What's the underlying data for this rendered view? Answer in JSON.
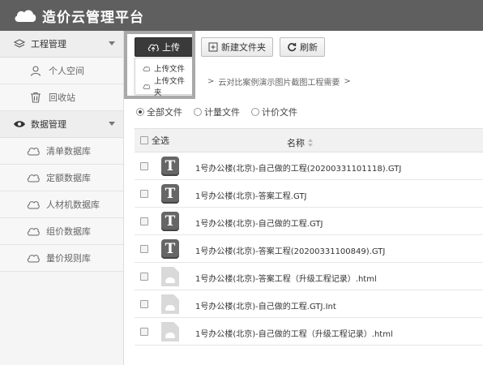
{
  "header": {
    "title": "造价云管理平台",
    "icon": "cloud-logo"
  },
  "sidebar": {
    "groups": [
      {
        "label": "工程管理",
        "icon": "layers-icon",
        "items": [
          {
            "label": "个人空间",
            "icon": "person-icon"
          },
          {
            "label": "回收站",
            "icon": "trash-icon"
          }
        ]
      },
      {
        "label": "数据管理",
        "icon": "eye-icon",
        "items": [
          {
            "label": "清单数据库",
            "icon": "cloud-icon"
          },
          {
            "label": "定额数据库",
            "icon": "cloud-icon"
          },
          {
            "label": "人材机数据库",
            "icon": "cloud-icon"
          },
          {
            "label": "组价数据库",
            "icon": "cloud-icon"
          },
          {
            "label": "量价规则库",
            "icon": "cloud-icon"
          }
        ]
      }
    ]
  },
  "toolbar": {
    "upload": "上传",
    "new_folder": "新建文件夹",
    "refresh": "刷新"
  },
  "upload_menu": {
    "items": [
      "上传文件",
      "上传文件夹"
    ]
  },
  "breadcrumb": {
    "sep": ">",
    "path": "云对比案例演示图片截图工程需要"
  },
  "filters": {
    "options": [
      "全部文件",
      "计量文件",
      "计价文件"
    ],
    "selected": "全部文件"
  },
  "table": {
    "select_all": "全选",
    "name_header": "名称",
    "rows": [
      {
        "name": "1号办公楼(北京)-自己做的工程(20200331101118).GTJ",
        "type": "gtj"
      },
      {
        "name": "1号办公楼(北京)-答案工程.GTJ",
        "type": "gtj"
      },
      {
        "name": "1号办公楼(北京)-自己做的工程.GTJ",
        "type": "gtj"
      },
      {
        "name": "1号办公楼(北京)-答案工程(20200331100849).GTJ",
        "type": "gtj"
      },
      {
        "name": "1号办公楼(北京)-答案工程（升级工程记录）.html",
        "type": "doc"
      },
      {
        "name": "1号办公楼(北京)-自己做的工程.GTJ.Int",
        "type": "doc"
      },
      {
        "name": "1号办公楼(北京)-自己做的工程（升级工程记录）.html",
        "type": "doc"
      }
    ]
  },
  "gtj_letter": "T",
  "colors": {
    "header_bg": "#5f5f5f",
    "primary_btn": "#3a3a3a",
    "sidebar_bg": "#f5f5f5"
  }
}
